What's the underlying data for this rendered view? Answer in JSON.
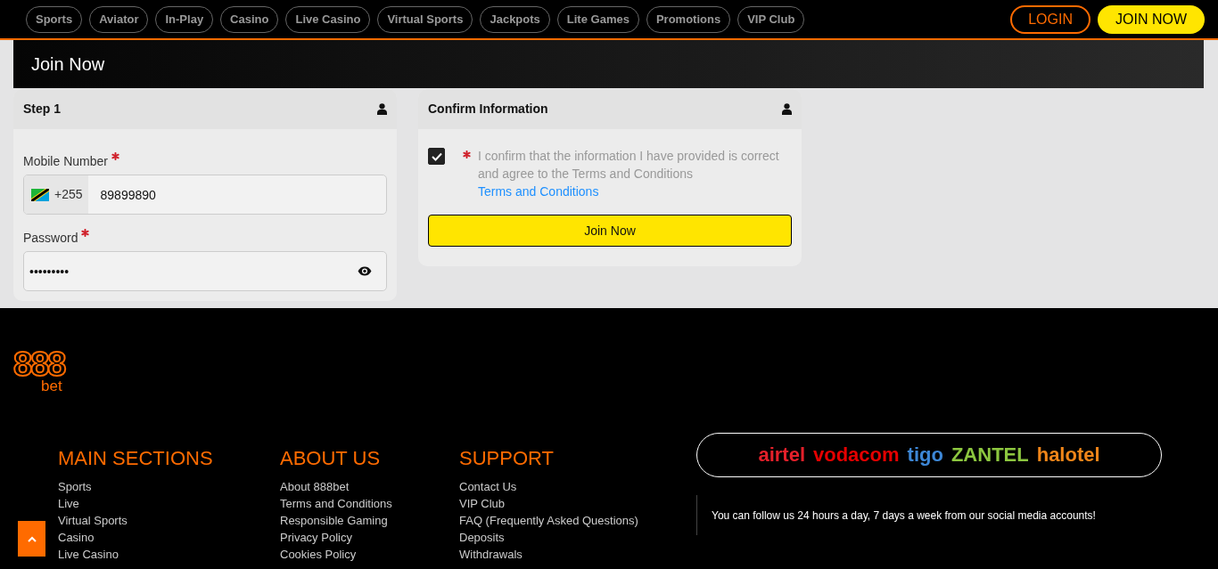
{
  "nav": {
    "items": [
      {
        "label": "Sports"
      },
      {
        "label": "Aviator"
      },
      {
        "label": "In-Play"
      },
      {
        "label": "Casino"
      },
      {
        "label": "Live Casino"
      },
      {
        "label": "Virtual Sports"
      },
      {
        "label": "Jackpots"
      },
      {
        "label": "Lite Games"
      },
      {
        "label": "Promotions"
      },
      {
        "label": "VIP Club"
      }
    ],
    "login": "LOGIN",
    "join": "JOIN NOW"
  },
  "page_title": "Join Now",
  "step_card": {
    "title": "Step 1",
    "fields": [
      {
        "kind": "phone",
        "label": "Mobile Number",
        "required": true,
        "prefix": "+255",
        "value": "89899890"
      },
      {
        "kind": "password",
        "label": "Password",
        "required": true,
        "value": "•••••••••"
      }
    ]
  },
  "confirm_card": {
    "title": "Confirm Information",
    "checked": true,
    "required": true,
    "text": "I confirm that the information I have provided is correct and agree to the Terms and Conditions",
    "link": "Terms and Conditions",
    "button": "Join Now"
  },
  "footer": {
    "logo": {
      "main": "888",
      "sub": "bet"
    },
    "columns": [
      {
        "heading": "MAIN SECTIONS",
        "links": [
          "Sports",
          "Live",
          "Virtual Sports",
          "Casino",
          "Live Casino"
        ]
      },
      {
        "heading": "ABOUT US",
        "links": [
          "About 888bet",
          "Terms and Conditions",
          "Responsible Gaming",
          "Privacy Policy",
          "Cookies Policy"
        ]
      },
      {
        "heading": "SUPPORT",
        "links": [
          "Contact Us",
          "VIP Club",
          "FAQ (Frequently Asked Questions)",
          "Deposits",
          "Withdrawals"
        ]
      }
    ],
    "operators": [
      {
        "name": "airtel",
        "color": "#e4202a"
      },
      {
        "name": "vodacom",
        "color": "#e60000"
      },
      {
        "name": "tigo",
        "color": "#3d87d6"
      },
      {
        "name": "ZANTEL",
        "color": "#8cc63f"
      },
      {
        "name": "halotel",
        "color": "#f08519"
      }
    ],
    "social_text": "You can follow us 24 hours a day, 7 days a week from our social media accounts!"
  }
}
